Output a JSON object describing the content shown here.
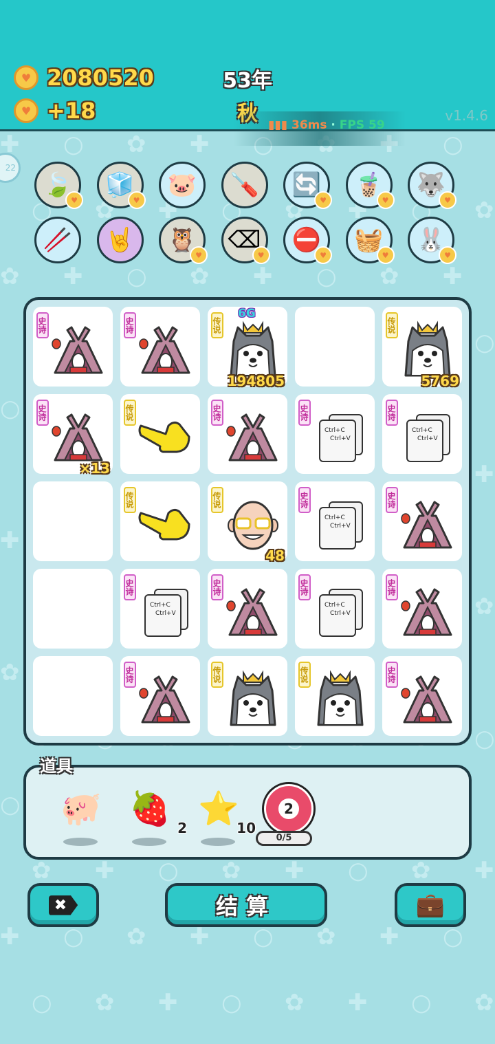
{
  "header": {
    "coins": "2080520",
    "income": "+18",
    "year": "53年",
    "season": "秋",
    "ping": "36ms",
    "fps": "FPS 59",
    "version": "v1.4.6",
    "side_button": "22"
  },
  "skills": [
    {
      "icon": "leaf-icon",
      "glyph": "🍃",
      "bg": "#dcdcd0",
      "heart": true
    },
    {
      "icon": "sugar-cubes-icon",
      "glyph": "🧊",
      "bg": "#dcdcd0",
      "heart": true
    },
    {
      "icon": "piggy-bank-icon",
      "glyph": "🐷",
      "bg": "#cdeffa",
      "heart": false
    },
    {
      "icon": "screwdriver-icon",
      "glyph": "🪛",
      "bg": "#dcdcd0",
      "heart": false
    },
    {
      "icon": "refresh-icon",
      "glyph": "🔄",
      "bg": "#cdeffa",
      "heart": true
    },
    {
      "icon": "bubble-tea-icon",
      "glyph": "🧋",
      "bg": "#cdeffa",
      "heart": true
    },
    {
      "icon": "husky-icon",
      "glyph": "🐺",
      "bg": "#cdeffa",
      "heart": true
    },
    {
      "icon": "chopsticks-icon",
      "glyph": "🥢",
      "bg": "#cdeffa",
      "heart": false
    },
    {
      "icon": "rock-hand-icon",
      "glyph": "🤘",
      "bg": "#d9b8ec",
      "heart": false
    },
    {
      "icon": "owl-icon",
      "glyph": "🦉",
      "bg": "#dcdcd0",
      "heart": true
    },
    {
      "icon": "delete-tag-icon",
      "glyph": "⌫",
      "bg": "#dcdcd0",
      "heart": true
    },
    {
      "icon": "minus-circle-icon",
      "glyph": "⛔",
      "bg": "#cdeffa",
      "heart": true
    },
    {
      "icon": "fruit-basket-icon",
      "glyph": "🧺",
      "bg": "#cdeffa",
      "heart": true
    },
    {
      "icon": "rabbit-icon",
      "glyph": "🐰",
      "bg": "#cdeffa",
      "heart": true
    }
  ],
  "board": [
    [
      {
        "type": "tent",
        "tag": "史诗",
        "rarity": "epic",
        "count": ""
      },
      {
        "type": "tent",
        "tag": "史诗",
        "rarity": "epic",
        "count": ""
      },
      {
        "type": "husky",
        "tag": "传说",
        "rarity": "legend",
        "count": "194805",
        "badge": "6G"
      },
      {
        "type": "empty"
      },
      {
        "type": "husky",
        "tag": "传说",
        "rarity": "legend",
        "count": "5769"
      }
    ],
    [
      {
        "type": "tent",
        "tag": "史诗",
        "rarity": "epic",
        "count": "×13"
      },
      {
        "type": "hand",
        "tag": "传说",
        "rarity": "legend",
        "count": ""
      },
      {
        "type": "tent",
        "tag": "史诗",
        "rarity": "epic",
        "count": ""
      },
      {
        "type": "copypaste",
        "tag": "史诗",
        "rarity": "epic",
        "count": ""
      },
      {
        "type": "copypaste",
        "tag": "史诗",
        "rarity": "epic",
        "count": ""
      }
    ],
    [
      {
        "type": "empty"
      },
      {
        "type": "hand",
        "tag": "传说",
        "rarity": "legend",
        "count": ""
      },
      {
        "type": "oldman",
        "tag": "传说",
        "rarity": "legend",
        "count": "48"
      },
      {
        "type": "copypaste",
        "tag": "史诗",
        "rarity": "epic",
        "count": ""
      },
      {
        "type": "tent",
        "tag": "史诗",
        "rarity": "epic",
        "count": ""
      }
    ],
    [
      {
        "type": "empty"
      },
      {
        "type": "copypaste",
        "tag": "史诗",
        "rarity": "epic",
        "count": ""
      },
      {
        "type": "tent",
        "tag": "史诗",
        "rarity": "epic",
        "count": ""
      },
      {
        "type": "copypaste",
        "tag": "史诗",
        "rarity": "epic",
        "count": ""
      },
      {
        "type": "tent",
        "tag": "史诗",
        "rarity": "epic",
        "count": ""
      }
    ],
    [
      {
        "type": "empty"
      },
      {
        "type": "tent",
        "tag": "史诗",
        "rarity": "epic",
        "count": ""
      },
      {
        "type": "husky",
        "tag": "传说",
        "rarity": "legend",
        "count": ""
      },
      {
        "type": "husky",
        "tag": "传说",
        "rarity": "legend",
        "count": ""
      },
      {
        "type": "tent",
        "tag": "史诗",
        "rarity": "epic",
        "count": ""
      }
    ]
  ],
  "copypaste_text": {
    "line1": "Ctrl+C",
    "line2": "Ctrl+V"
  },
  "items": {
    "label": "道具",
    "list": [
      {
        "icon": "piggy-bank-icon",
        "glyph": "🐖",
        "count": ""
      },
      {
        "icon": "bayberry-icon",
        "glyph": "🍓",
        "count": "2"
      },
      {
        "icon": "star-icon",
        "glyph": "⭐",
        "count": "10"
      },
      {
        "icon": "target-icon",
        "glyph": "",
        "count": "2",
        "progress": "0/5"
      }
    ]
  },
  "buttons": {
    "remove_glyph": "✖",
    "settle_label": "结算",
    "bag_glyph": "💼"
  }
}
